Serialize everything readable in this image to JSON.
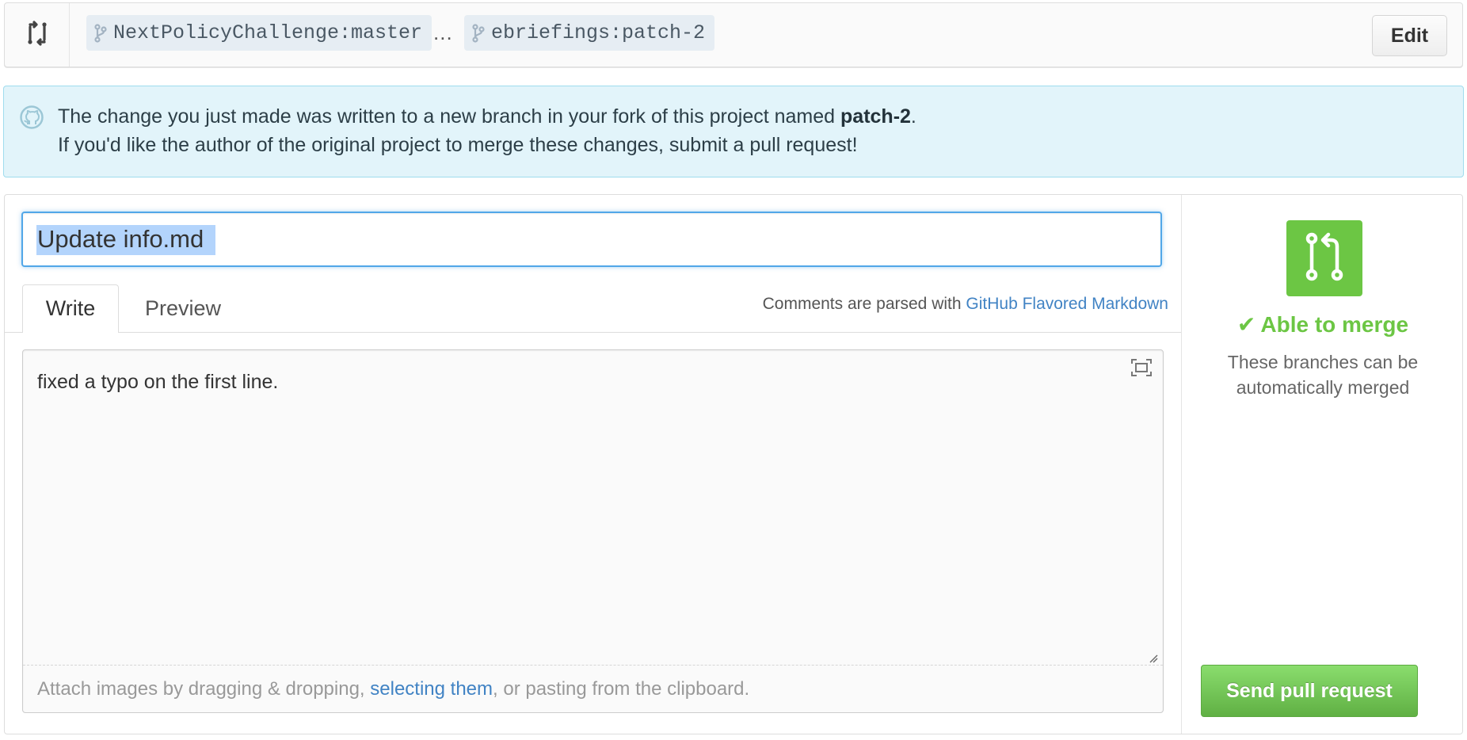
{
  "compare": {
    "base_branch": "NextPolicyChallenge:master",
    "ellipsis": "...",
    "head_branch": "ebriefings:patch-2",
    "edit_label": "Edit",
    "icons": [
      "compare-arrows-icon",
      "git-branch-icon"
    ]
  },
  "flash": {
    "line1_prefix": "The change you just made was written to a new branch in your fork of this project named ",
    "branch_name": "patch-2",
    "line1_suffix": ".",
    "line2": "If you'd like the author of the original project to merge these changes, submit a pull request!",
    "icon": "octocat-icon"
  },
  "composer": {
    "title_value": "Update info.md",
    "tabs": [
      {
        "label": "Write",
        "active": true
      },
      {
        "label": "Preview",
        "active": false
      }
    ],
    "markdown_hint_prefix": "Comments are parsed with ",
    "markdown_link": "GitHub Flavored Markdown",
    "body_value": "fixed a typo on the first line.",
    "attach_prefix": "Attach images by dragging & dropping, ",
    "attach_link": "selecting them",
    "attach_suffix": ", or pasting from the clipboard."
  },
  "merge": {
    "status": "Able to merge",
    "description_line1": "These branches can be",
    "description_line2": "automatically merged",
    "send_label": "Send pull request",
    "status_color": "#6cc644",
    "icon": "pull-request-icon"
  },
  "colors": {
    "accent_green": "#6cc644",
    "link_blue": "#4183c4",
    "focus_blue": "#51a7e8",
    "flash_bg": "#e2f4fa"
  }
}
